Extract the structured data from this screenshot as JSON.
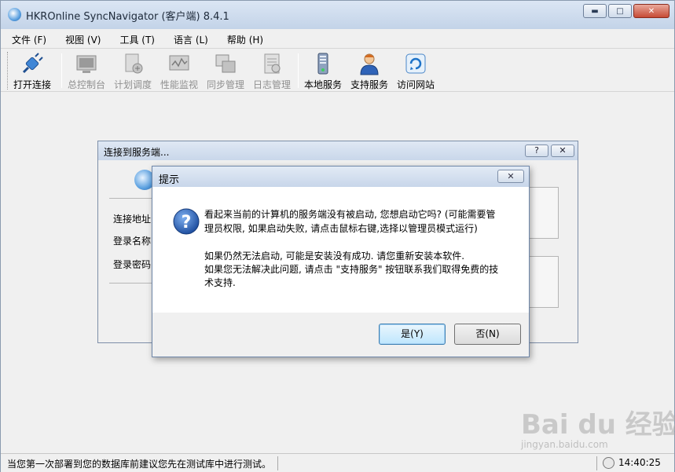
{
  "window": {
    "title": "HKROnline SyncNavigator (客户端) 8.4.1"
  },
  "titlebar_buttons": {
    "minimize": "▬",
    "maximize": "□",
    "close": "✕"
  },
  "menu": [
    {
      "label": "文件 (F)"
    },
    {
      "label": "视图 (V)"
    },
    {
      "label": "工具 (T)"
    },
    {
      "label": "语言 (L)"
    },
    {
      "label": "帮助 (H)"
    }
  ],
  "toolbar": [
    {
      "label": "打开连接",
      "icon": "plug-icon",
      "enabled": true
    },
    {
      "label": "总控制台",
      "icon": "console-icon",
      "enabled": false
    },
    {
      "label": "计划调度",
      "icon": "schedule-icon",
      "enabled": false
    },
    {
      "label": "性能监视",
      "icon": "monitor-icon",
      "enabled": false
    },
    {
      "label": "同步管理",
      "icon": "sync-manage-icon",
      "enabled": false
    },
    {
      "label": "日志管理",
      "icon": "log-icon",
      "enabled": false
    },
    {
      "label": "本地服务",
      "icon": "server-icon",
      "enabled": true
    },
    {
      "label": "支持服务",
      "icon": "support-person-icon",
      "enabled": true
    },
    {
      "label": "访问网站",
      "icon": "web-refresh-icon",
      "enabled": true
    }
  ],
  "connect_dialog": {
    "title": "连接到服务端...",
    "help_button": "?",
    "close_button": "✕",
    "fields": [
      {
        "label": "连接地址"
      },
      {
        "label": "登录名称"
      },
      {
        "label": "登录密码"
      }
    ]
  },
  "prompt_dialog": {
    "title": "提示",
    "close_button": "✕",
    "message_1_line_1": "看起来当前的计算机的服务端没有被启动, 您想启动它吗? (可能需要管",
    "message_1_line_2": "理员权限, 如果启动失败, 请点击鼠标右键,选择以管理员模式运行)",
    "message_2_line_1": "如果仍然无法启动, 可能是安装没有成功. 请您重新安装本软件.",
    "message_2_line_2": "如果您无法解决此问题, 请点击 \"支持服务\" 按钮联系我们取得免费的技",
    "message_2_line_3": "术支持.",
    "yes_button": "是(Y)",
    "no_button": "否(N)"
  },
  "statusbar": {
    "message": "当您第一次部署到您的数据库前建议您先在测试库中进行测试。",
    "time": "14:40:25"
  },
  "watermark": {
    "logo": "Bai du 经验",
    "sub": "jingyan.baidu.com"
  },
  "colors": {
    "titlebar": "#c3d3e8",
    "window_bg": "#f0f0f0",
    "question_icon": "#1f4fa0",
    "default_button": "#bee6fd"
  }
}
